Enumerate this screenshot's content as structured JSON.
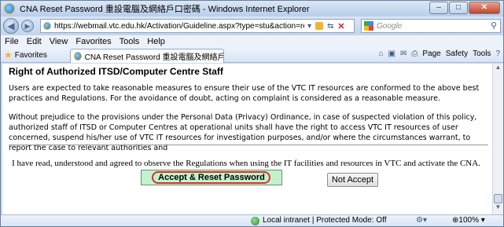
{
  "window": {
    "title": "CNA Reset Password 重設電腦及網絡戶口密碼 - Windows Internet Explorer",
    "min": "–",
    "max": "□",
    "close": "✕"
  },
  "address": {
    "url": "https://webmail.vtc.edu.hk/Activation/Guideline.aspx?type=stu&action=resetpassv",
    "search_placeholder": "Google"
  },
  "menu": [
    "File",
    "Edit",
    "View",
    "Favorites",
    "Tools",
    "Help"
  ],
  "favorites": {
    "label": "Favorites",
    "tab_title": "CNA Reset Password 重設電腦及網絡戶口密碼",
    "page": "Page",
    "safety": "Safety",
    "tools": "Tools"
  },
  "content": {
    "heading": "Right of Authorized ITSD/Computer Centre Staff",
    "paragraph1": "Users are expected to take reasonable measures to ensure their use of the VTC IT resources are conformed to the above best practices and Regulations. For the avoidance of doubt, acting on complaint is considered as a reasonable measure.",
    "paragraph2": "Without prejudice to the provisions under the Personal Data (Privacy) Ordinance, in case of suspected violation of this policy, authorized staff of ITSD or Computer Centres at operational units shall have the right to access VTC IT resources of user concerned, suspend his/her use of VTC IT resources for investigation purposes, and/or where the circumstances warrant, to report the case to relevant authorities and",
    "agreement": "I have read, understood and agreed to observe the Regulations when using the IT facilities and resources in VTC and activate the CNA.",
    "accept_label": "Accept & Reset Password",
    "not_accept_label": "Not Accept"
  },
  "status": {
    "zone": "Local intranet | Protected Mode: Off",
    "zoom": "100%"
  }
}
